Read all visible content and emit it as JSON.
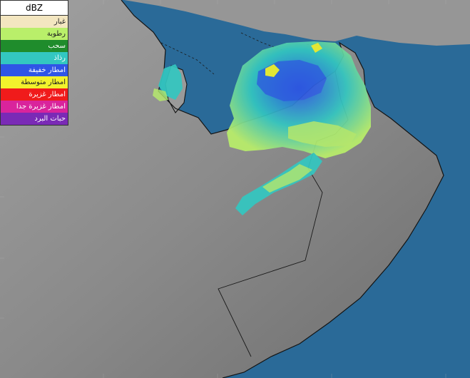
{
  "legend": {
    "title": "dBZ",
    "items": [
      {
        "label": "غبار",
        "color": "#f3e6c0",
        "text": "#222222"
      },
      {
        "label": "رطوبة",
        "color": "#b9ef6a",
        "text": "#222222"
      },
      {
        "label": "سحب",
        "color": "#1f8c2c",
        "text": "#ffffff"
      },
      {
        "label": "رذاذ",
        "color": "#33c7c1",
        "text": "#ffffff"
      },
      {
        "label": "امطار خفيفة",
        "color": "#2f55e6",
        "text": "#ffffff"
      },
      {
        "label": "امطار متوسطة",
        "color": "#f2f22c",
        "text": "#222222"
      },
      {
        "label": "امطار غزيرة",
        "color": "#f01b1b",
        "text": "#ffffff"
      },
      {
        "label": "امطار غزيرة جدا",
        "color": "#d9249c",
        "text": "#ffffff"
      },
      {
        "label": "حبات البرد",
        "color": "#7a2ab6",
        "text": "#ffffff"
      }
    ]
  },
  "colors": {
    "sea": "#2a6a98",
    "land": "#8c8c8c",
    "coast": "#141414"
  }
}
